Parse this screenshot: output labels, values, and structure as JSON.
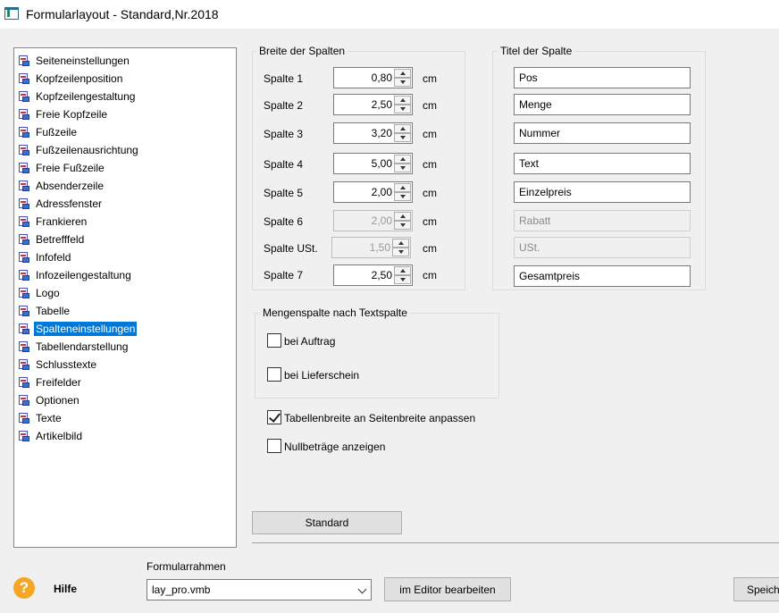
{
  "window": {
    "title": "Formularlayout - Standard,Nr.2018"
  },
  "tree": {
    "items": [
      {
        "label": "Seiteneinstellungen"
      },
      {
        "label": "Kopfzeilenposition"
      },
      {
        "label": "Kopfzeilengestaltung"
      },
      {
        "label": "Freie Kopfzeile"
      },
      {
        "label": "Fußzeile"
      },
      {
        "label": "Fußzeilenausrichtung"
      },
      {
        "label": "Freie Fußzeile"
      },
      {
        "label": "Absenderzeile"
      },
      {
        "label": "Adressfenster"
      },
      {
        "label": "Frankieren"
      },
      {
        "label": "Betrefffeld"
      },
      {
        "label": "Infofeld"
      },
      {
        "label": "Infozeilengestaltung"
      },
      {
        "label": "Logo"
      },
      {
        "label": "Tabelle"
      },
      {
        "label": "Spalteneinstellungen",
        "selected": true
      },
      {
        "label": "Tabellendarstellung"
      },
      {
        "label": "Schlusstexte"
      },
      {
        "label": "Freifelder"
      },
      {
        "label": "Optionen"
      },
      {
        "label": "Texte"
      },
      {
        "label": "Artikelbild"
      }
    ]
  },
  "widths": {
    "title": "Breite der Spalten",
    "unit": "cm",
    "rows": [
      {
        "label": "Spalte 1",
        "value": "0,80",
        "enabled": true
      },
      {
        "label": "Spalte 2",
        "value": "2,50",
        "enabled": true
      },
      {
        "label": "Spalte 3",
        "value": "3,20",
        "enabled": true
      },
      {
        "label": "Spalte 4",
        "value": "5,00",
        "enabled": true
      },
      {
        "label": "Spalte 5",
        "value": "2,00",
        "enabled": true
      },
      {
        "label": "Spalte 6",
        "value": "2,00",
        "enabled": false
      },
      {
        "label": "Spalte USt.",
        "value": "1,50",
        "enabled": false
      },
      {
        "label": "Spalte 7",
        "value": "2,50",
        "enabled": true
      }
    ]
  },
  "titles": {
    "title": "Titel der Spalte",
    "fields": [
      {
        "value": "Pos",
        "enabled": true
      },
      {
        "value": "Menge",
        "enabled": true
      },
      {
        "value": "Nummer",
        "enabled": true
      },
      {
        "value": "Text",
        "enabled": true
      },
      {
        "value": "Einzelpreis",
        "enabled": true
      },
      {
        "value": "Rabatt",
        "enabled": false
      },
      {
        "value": "USt.",
        "enabled": false
      },
      {
        "value": "Gesamtpreis",
        "enabled": true
      }
    ]
  },
  "mengenspalte": {
    "title": "Mengenspalte nach Textspalte",
    "bei_auftrag": {
      "label": "bei Auftrag",
      "checked": false
    },
    "bei_lieferschein": {
      "label": "bei Lieferschein",
      "checked": false
    }
  },
  "options": {
    "tabellenbreite": {
      "label": "Tabellenbreite an Seitenbreite anpassen",
      "checked": true
    },
    "nullbetraege": {
      "label": "Nullbeträge anzeigen",
      "checked": false
    }
  },
  "buttons": {
    "standard": "Standard",
    "editor": "im Editor bearbeiten",
    "save": "Speich"
  },
  "footer": {
    "help_label": "Hilfe",
    "help_icon_glyph": "?",
    "formularrahmen_label": "Formularrahmen",
    "formularrahmen_value": "lay_pro.vmb"
  },
  "colors": {
    "selection": "#0078d7",
    "help": "#f5a623"
  }
}
